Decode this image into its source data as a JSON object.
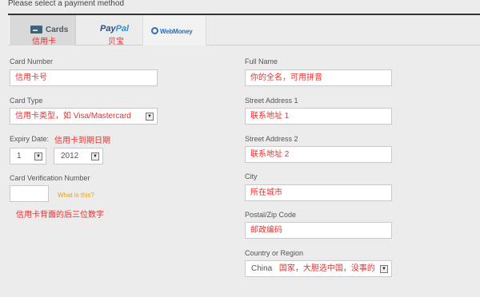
{
  "header": {
    "title": "Please select a payment method"
  },
  "tabs": [
    {
      "label": "Cards",
      "note": "信用卡",
      "icon": "credit-card-icon"
    },
    {
      "label_main": "Pay",
      "label_accent": "Pal",
      "note": "贝宝"
    },
    {
      "label": "WebMoney",
      "icon": "webmoney-icon"
    }
  ],
  "left": {
    "card_number": {
      "label": "Card Number",
      "value": "信用卡号"
    },
    "card_type": {
      "label": "Card Type",
      "value": "信用卡类型，如 Visa/Mastercard"
    },
    "expiry": {
      "label": "Expiry Date:",
      "note": "信用卡到期日期",
      "month": "1",
      "year": "2012"
    },
    "cvn": {
      "label": "Card Verification Number",
      "value": "",
      "help": "What is this?",
      "note": "信用卡背面的后三位数字"
    }
  },
  "right": {
    "full_name": {
      "label": "Full Name",
      "value": "你的全名，可用拼音"
    },
    "street1": {
      "label": "Street Address 1",
      "value": "联系地址 1"
    },
    "street2": {
      "label": "Street Address 2",
      "value": "联系地址 2"
    },
    "city": {
      "label": "City",
      "value": "所在城市"
    },
    "postal": {
      "label": "Postal/Zip Code",
      "value": "邮政编码"
    },
    "country": {
      "label": "Country or Region",
      "value": "China",
      "note": "国家，大胆选中国，没事的"
    }
  },
  "colors": {
    "accent_red": "#e53030",
    "paypal_blue": "#2b4e86",
    "help_orange": "#e8a020"
  }
}
